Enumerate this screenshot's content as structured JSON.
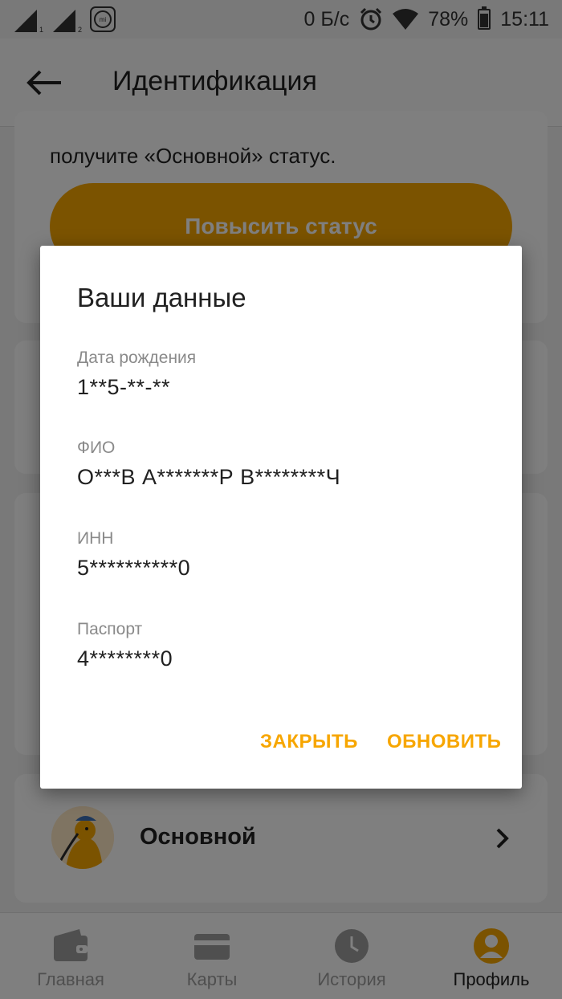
{
  "status_bar": {
    "sim1": "1",
    "sim2": "2",
    "mi_label": "mi",
    "network_speed": "0 Б/с",
    "battery": "78%",
    "time": "15:11"
  },
  "app_bar": {
    "title": "Идентификация"
  },
  "background": {
    "status_hint": "получите «Основной» статус.",
    "upgrade_button": "Повысить статус",
    "level_name": "Основной"
  },
  "dialog": {
    "title": "Ваши данные",
    "fields": [
      {
        "label": "Дата рождения",
        "value": "1**5-**-**"
      },
      {
        "label": "ФИО",
        "value": "О***В А*******Р В********Ч"
      },
      {
        "label": "ИНН",
        "value": "5**********0"
      },
      {
        "label": "Паспорт",
        "value": "4********0"
      }
    ],
    "close_button": "ЗАКРЫТЬ",
    "update_button": "ОБНОВИТЬ"
  },
  "bottom_nav": {
    "items": [
      {
        "label": "Главная",
        "icon": "wallet-icon"
      },
      {
        "label": "Карты",
        "icon": "card-icon"
      },
      {
        "label": "История",
        "icon": "clock-icon"
      },
      {
        "label": "Профиль",
        "icon": "profile-icon"
      }
    ],
    "active_index": 3
  },
  "colors": {
    "accent": "#f7a600",
    "scrim": "rgba(0,0,0,0.5)"
  }
}
